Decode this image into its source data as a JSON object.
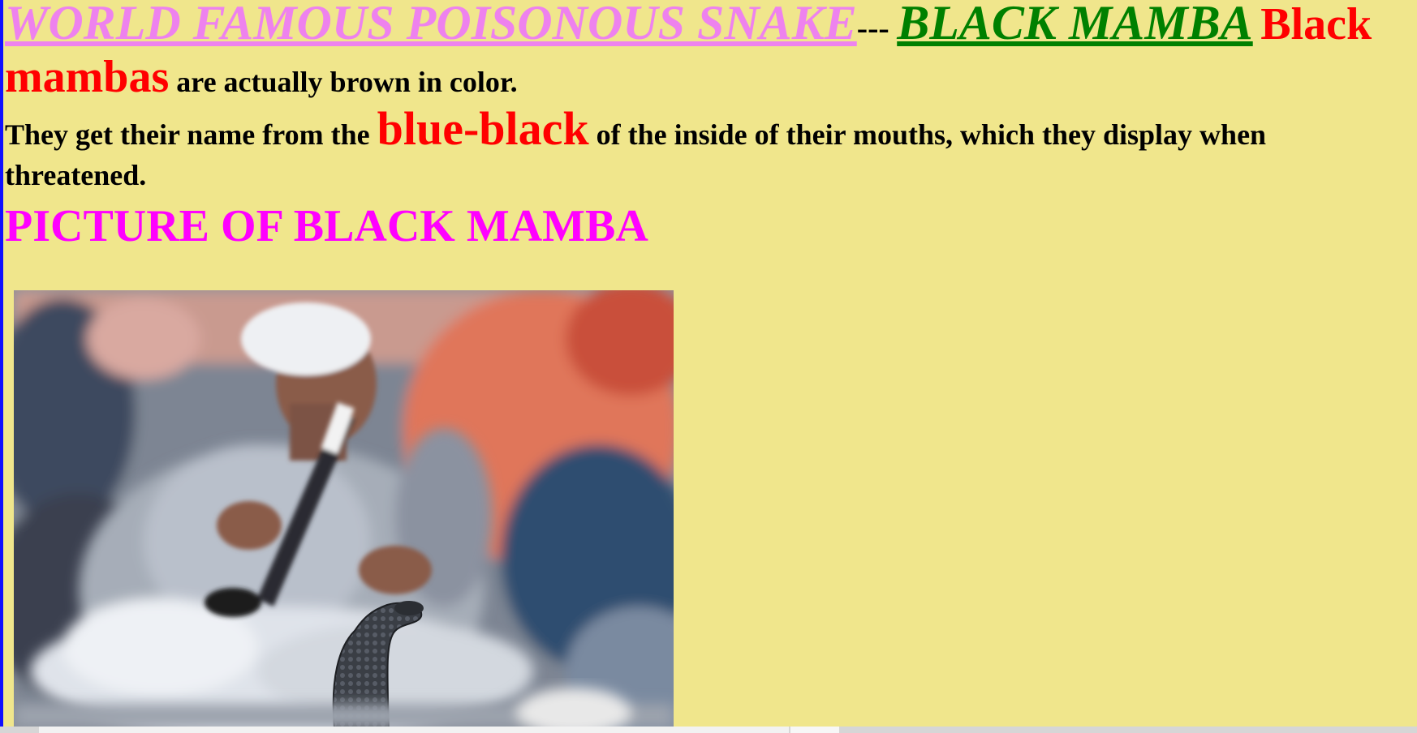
{
  "header": {
    "title_link": "WORLD FAMOUS POISONOUS SNAKE",
    "separator": "---",
    "name_link": "BLACK MAMBA",
    "lead_red": "Black"
  },
  "intro": {
    "red_word": "mambas",
    "rest": "are actually brown in color."
  },
  "paragraph": {
    "before": "They get their name from the",
    "highlight": "blue-black",
    "after": "of the inside of their mouths, which they display when threatened."
  },
  "section_heading": "PICTURE OF BLACK MAMBA",
  "photo": {
    "alt": "snake charmer with cobra"
  },
  "colors": {
    "background": "#f0e68c",
    "title_link": "#ee82ee",
    "name_link": "#008000",
    "emphasis": "#ff0000",
    "heading": "#ff00ff",
    "left_bar": "#1010ff"
  }
}
